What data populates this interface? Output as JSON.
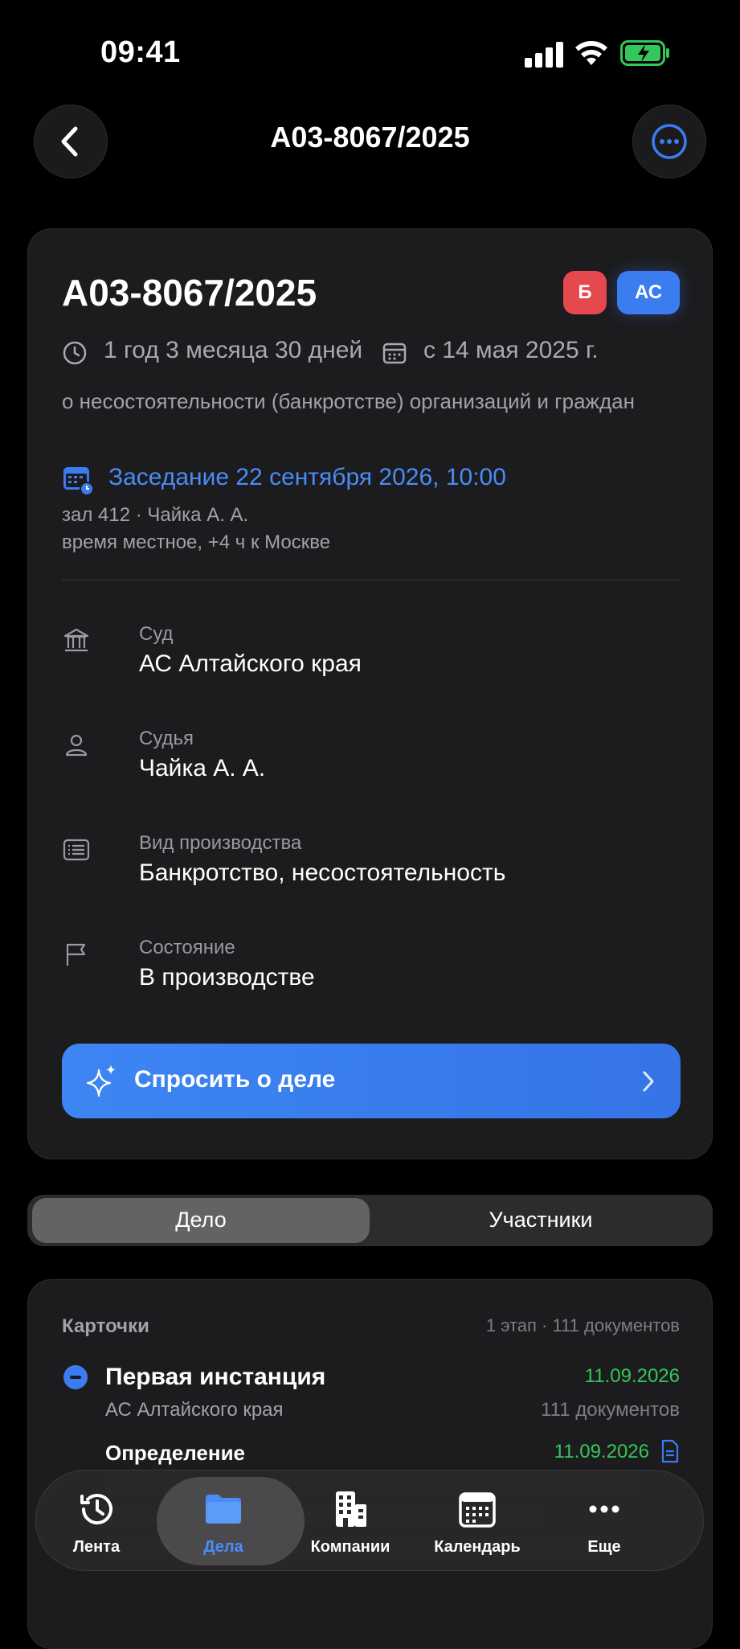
{
  "status_bar": {
    "time": "09:41"
  },
  "header": {
    "title": "А03-8067/2025"
  },
  "case": {
    "number": "А03-8067/2025",
    "badges": [
      "Б",
      "АС"
    ],
    "duration": "1 год 3 месяца 30 дней",
    "since": "с 14 мая 2025 г.",
    "category": "о несостоятельности (банкротстве) организаций и граждан",
    "hearing": {
      "title": "Заседание 22 сентября 2026, 10:00",
      "room": "зал 412 · Чайка А. А.",
      "timezone": "время местное, +4 ч к Москве"
    },
    "fields": [
      {
        "label": "Суд",
        "value": "АС Алтайского края",
        "icon": "court-icon"
      },
      {
        "label": "Судья",
        "value": "Чайка А. А.",
        "icon": "person-icon"
      },
      {
        "label": "Вид производства",
        "value": "Банкротство, несостоятельность",
        "icon": "list-icon"
      },
      {
        "label": "Состояние",
        "value": "В производстве",
        "icon": "flag-icon"
      }
    ],
    "ask_button": "Спросить о деле"
  },
  "segmented": {
    "tabs": [
      "Дело",
      "Участники"
    ],
    "selected": "Дело"
  },
  "cards": {
    "heading": "Карточки",
    "stats": "1 этап · 111 документов",
    "instance": {
      "title": "Первая инстанция",
      "date": "11.09.2026",
      "court": "АС Алтайского края",
      "count": "111 документов"
    },
    "document": {
      "title": "Определение",
      "date": "11.09.2026"
    }
  },
  "tabbar": {
    "items": [
      {
        "label": "Лента",
        "icon": "history-icon"
      },
      {
        "label": "Дела",
        "icon": "folder-icon"
      },
      {
        "label": "Компании",
        "icon": "building-icon"
      },
      {
        "label": "Календарь",
        "icon": "calendar-icon"
      },
      {
        "label": "Еще",
        "icon": "more-dots-icon"
      }
    ],
    "active": "Дела"
  },
  "colors": {
    "accent": "#3b7cf0",
    "green": "#34c759",
    "danger_badge": "#e5484d",
    "background": "#000000",
    "card": "#1c1c1e"
  }
}
